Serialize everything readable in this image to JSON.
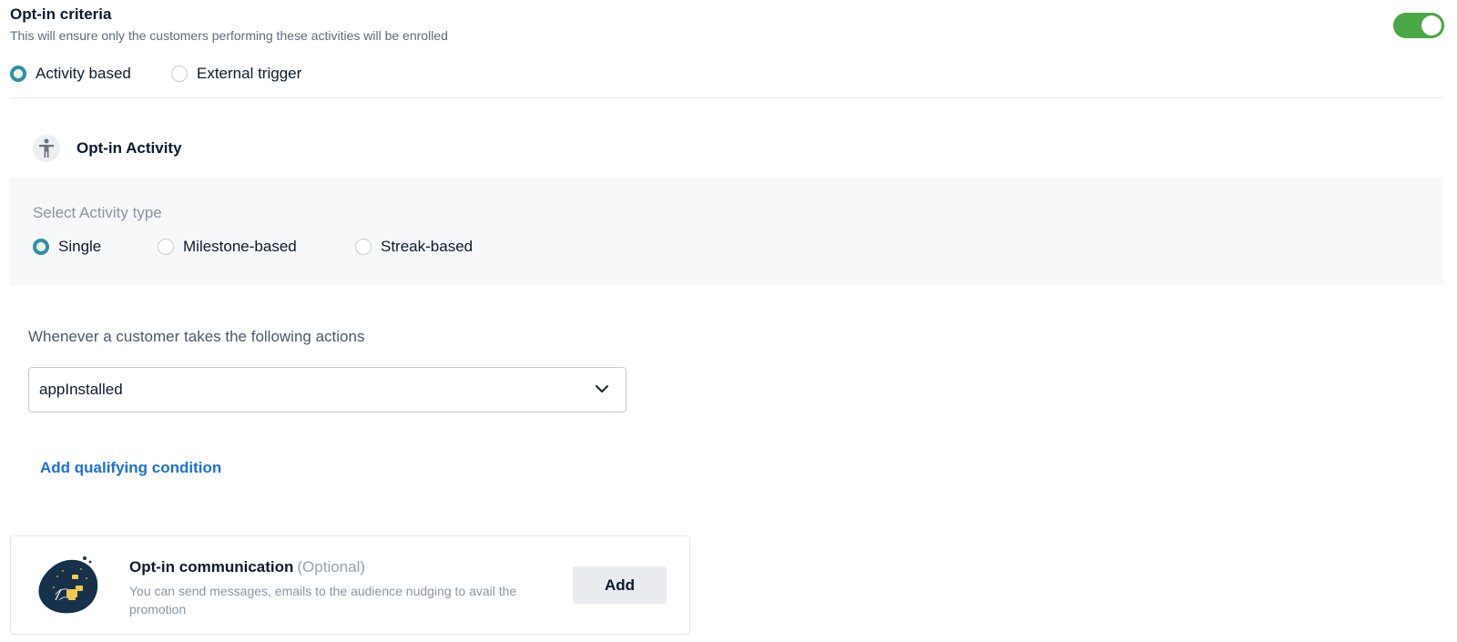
{
  "colors": {
    "toggle_on": "#48a843",
    "radio_checked": "#2f8fa6",
    "link": "#1a6fd6",
    "panel_bg": "#f7f8fa"
  },
  "header": {
    "title": "Opt-in criteria",
    "subtitle": "This will ensure only the customers performing these activities will be enrolled",
    "toggle_state": "on"
  },
  "trigger_options": [
    {
      "label": "Activity based",
      "checked": true
    },
    {
      "label": "External trigger",
      "checked": false
    }
  ],
  "activity": {
    "icon": "accessibility-person-icon",
    "title": "Opt-in Activity",
    "type_label": "Select Activity type",
    "types": [
      {
        "label": "Single",
        "checked": true
      },
      {
        "label": "Milestone-based",
        "checked": false
      },
      {
        "label": "Streak-based",
        "checked": false
      }
    ]
  },
  "actions": {
    "label": "Whenever a customer takes the following actions",
    "selected": "appInstalled",
    "add_condition": "Add qualifying condition"
  },
  "communication": {
    "title": "Opt-in communication",
    "optional": "(Optional)",
    "description": "You can send messages, emails to the audience nudging to avail the promotion",
    "button": "Add"
  }
}
